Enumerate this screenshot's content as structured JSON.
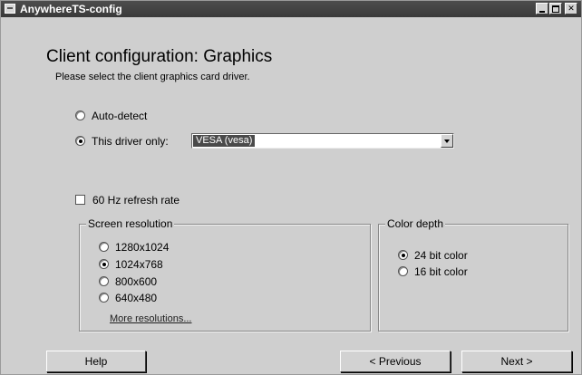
{
  "window": {
    "title": "AnywhereTS-config"
  },
  "header": {
    "title": "Client configuration: Graphics",
    "subtitle": "Please select the client graphics card driver."
  },
  "driver": {
    "auto_detect_label": "Auto-detect",
    "this_driver_label": "This driver only:",
    "selected_mode": "this_driver_only",
    "selected_driver": "VESA (vesa)"
  },
  "refresh": {
    "label": "60 Hz refresh rate",
    "checked": false
  },
  "resolution": {
    "legend": "Screen resolution",
    "options": [
      "1280x1024",
      "1024x768",
      "800x600",
      "640x480"
    ],
    "selected": "1024x768",
    "more_link": "More resolutions..."
  },
  "color_depth": {
    "legend": "Color depth",
    "options": [
      "24 bit color",
      "16 bit color"
    ],
    "selected": "24 bit color"
  },
  "buttons": {
    "help": "Help",
    "previous": "< Previous",
    "next": "Next >"
  },
  "icons": {
    "app": "app-menu-icon",
    "minimize": "minimize-icon",
    "maximize": "maximize-icon",
    "close": "close-icon",
    "dropdown": "chevron-down-icon"
  }
}
